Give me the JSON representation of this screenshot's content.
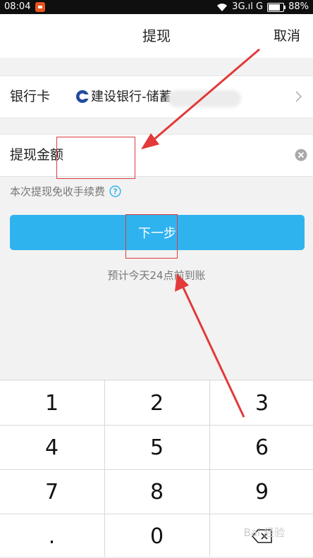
{
  "status_bar": {
    "time": "08:04",
    "network": "3G.ıl G",
    "battery": "88%"
  },
  "nav": {
    "title": "提现",
    "cancel_label": "取消"
  },
  "bank": {
    "label": "银行卡",
    "name": "建设银行-储蓄"
  },
  "amount": {
    "label": "提现金额",
    "value": ""
  },
  "fee_note": "本次提现免收手续费",
  "next_label": "下一步",
  "eta_note": "预计今天24点前到账",
  "keypad": {
    "keys": [
      "1",
      "2",
      "3",
      "4",
      "5",
      "6",
      "7",
      "8",
      "9",
      ".",
      "0"
    ],
    "backspace": "backspace-icon"
  },
  "watermark": "Bai 经验",
  "colors": {
    "accent": "#2fb3ef",
    "annotation": "#e23a3a",
    "bank_logo": "#1f4b9c"
  }
}
